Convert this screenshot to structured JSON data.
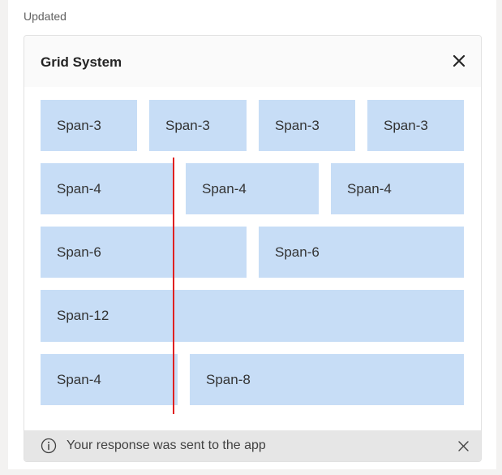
{
  "header": {
    "status_label": "Updated"
  },
  "card": {
    "title": "Grid System",
    "rows": [
      [
        "Span-3",
        "Span-3",
        "Span-3",
        "Span-3"
      ],
      [
        "Span-4",
        "Span-4",
        "Span-4"
      ],
      [
        "Span-6",
        "Span-6"
      ],
      [
        "Span-12"
      ],
      [
        "Span-4",
        "Span-8"
      ]
    ]
  },
  "status_bar": {
    "message": "Your response was sent to the app"
  },
  "colors": {
    "cell_bg": "#c7ddf6",
    "divider_line": "#e02020",
    "status_bg": "#e6e6e6"
  },
  "icons": {
    "close": "close-icon",
    "info": "info-icon",
    "dismiss": "dismiss-icon"
  }
}
